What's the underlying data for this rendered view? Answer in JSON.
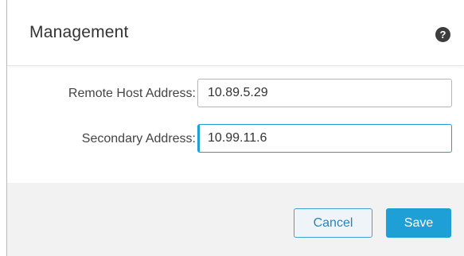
{
  "dialog": {
    "title": "Management",
    "help_icon": "question-mark-icon",
    "help_glyph": "?"
  },
  "form": {
    "remote_host": {
      "label": "Remote Host Address:",
      "value": "10.89.5.29"
    },
    "secondary": {
      "label": "Secondary Address:",
      "value": "10.99.11.6"
    }
  },
  "footer": {
    "cancel_label": "Cancel",
    "save_label": "Save"
  },
  "colors": {
    "accent": "#1e9fd6",
    "footer_bg": "#f2f2f2",
    "help_icon_bg": "#3d3d3d"
  }
}
